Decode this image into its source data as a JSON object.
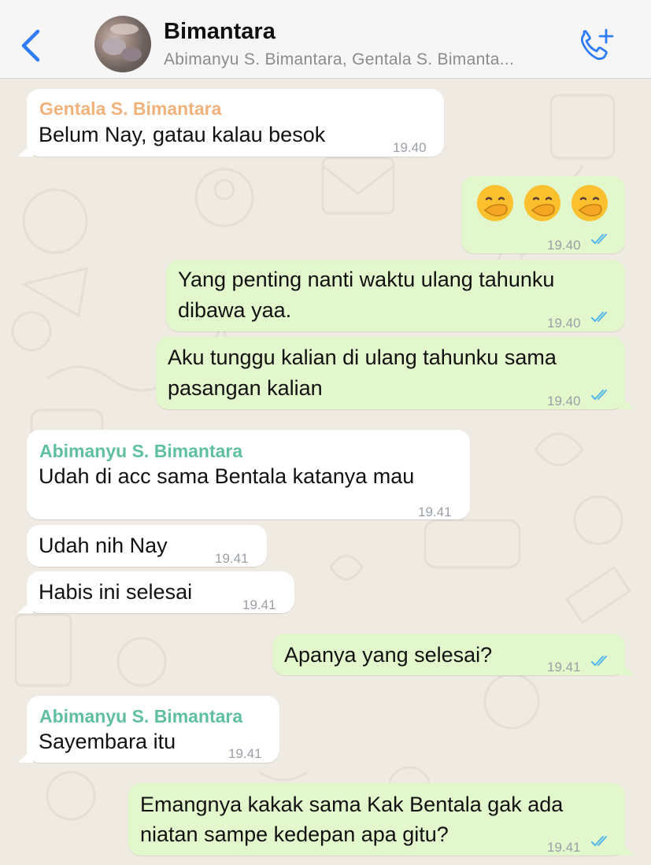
{
  "header": {
    "back_icon": "chevron-left-icon",
    "title": "Bimantara",
    "subtitle": "Abimanyu S. Bimantara, Gentala S. Bimanta...",
    "call_icon": "add-call-icon",
    "accent": "#2f7cf6"
  },
  "colors": {
    "incoming_bubble": "#ffffff",
    "outgoing_bubble": "#e2f7cb",
    "sender_gentala": "#f0b27a",
    "sender_abimanyu": "#5fbf9f",
    "read_ticks": "#4fb6ec"
  },
  "messages": [
    {
      "direction": "in",
      "sender": "Gentala S. Bimantara",
      "text": "Belum Nay, gatau kalau besok",
      "time": "19.40"
    },
    {
      "direction": "out",
      "emoji": [
        "face-with-hand-over-mouth",
        "face-with-hand-over-mouth",
        "face-with-hand-over-mouth"
      ],
      "time": "19.40",
      "status": "read"
    },
    {
      "direction": "out",
      "lines": [
        "Yang penting nanti waktu ulang tahunku",
        "dibawa yaa."
      ],
      "time": "19.40",
      "status": "read"
    },
    {
      "direction": "out",
      "lines": [
        "Aku tunggu kalian di ulang tahunku sama",
        "pasangan kalian"
      ],
      "time": "19.40",
      "status": "read"
    },
    {
      "direction": "in",
      "sender": "Abimanyu S. Bimantara",
      "text": "Udah di acc sama Bentala katanya mau",
      "time": "19.41"
    },
    {
      "direction": "in",
      "text": "Udah nih Nay",
      "time": "19.41"
    },
    {
      "direction": "in",
      "text": "Habis ini selesai",
      "time": "19.41"
    },
    {
      "direction": "out",
      "text": "Apanya yang selesai?",
      "time": "19.41",
      "status": "read"
    },
    {
      "direction": "in",
      "sender": "Abimanyu S. Bimantara",
      "text": "Sayembara itu",
      "time": "19.41"
    },
    {
      "direction": "out",
      "lines": [
        "Emangnya kakak sama Kak Bentala gak ada",
        "niatan sampe kedepan apa gitu?"
      ],
      "time": "19.41",
      "status": "read"
    }
  ]
}
